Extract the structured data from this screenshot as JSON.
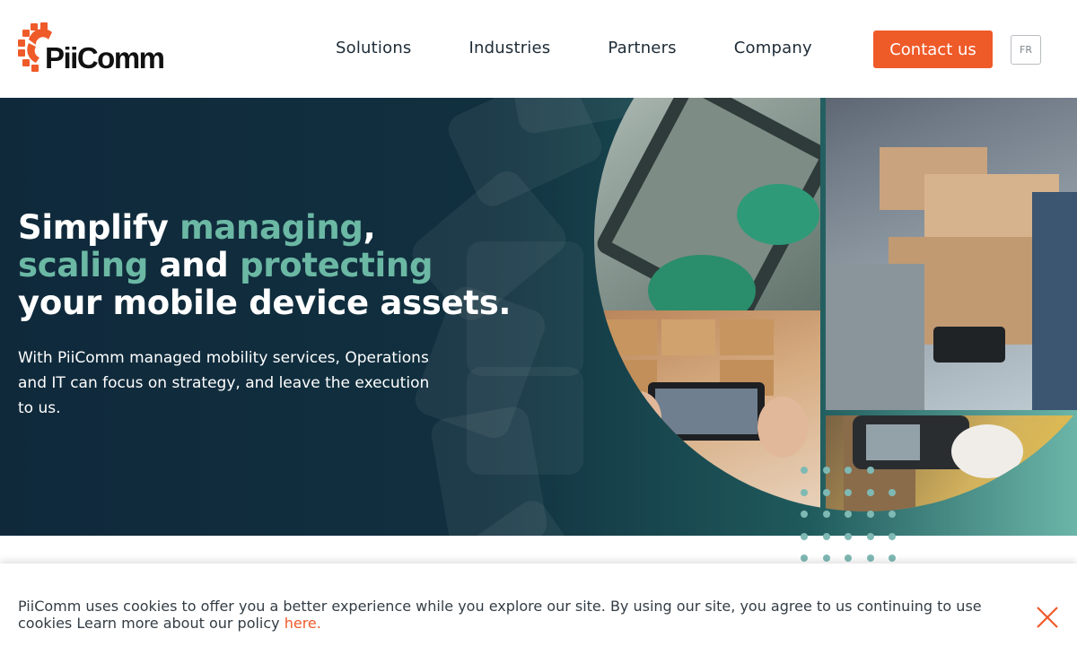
{
  "header": {
    "logo_text": "PiiComm",
    "nav": [
      "Solutions",
      "Industries",
      "Partners",
      "Company"
    ],
    "contact_label": "Contact us",
    "lang_label": "FR"
  },
  "hero": {
    "title_line1_a": "Simplify ",
    "title_line1_b": "managing",
    "title_line1_c": ",",
    "title_line2_a": "scaling",
    "title_line2_b": " and ",
    "title_line2_c": "protecting",
    "title_line3": "your mobile device assets.",
    "subtitle": "With PiiComm managed mobility services, Operations and IT can focus on strategy, and leave the execution to us."
  },
  "cookie": {
    "text": "PiiComm uses cookies to offer you a better experience while you explore our site. By using our site, you agree to us continuing to use cookies Learn more about our policy ",
    "link_label": "here."
  },
  "colors": {
    "brand_orange": "#ef5a29",
    "hero_dark": "#102a3c",
    "accent_teal": "#6bb8a4"
  },
  "icons": {
    "logo": "piicomm-gear-logo",
    "close": "close-icon"
  }
}
